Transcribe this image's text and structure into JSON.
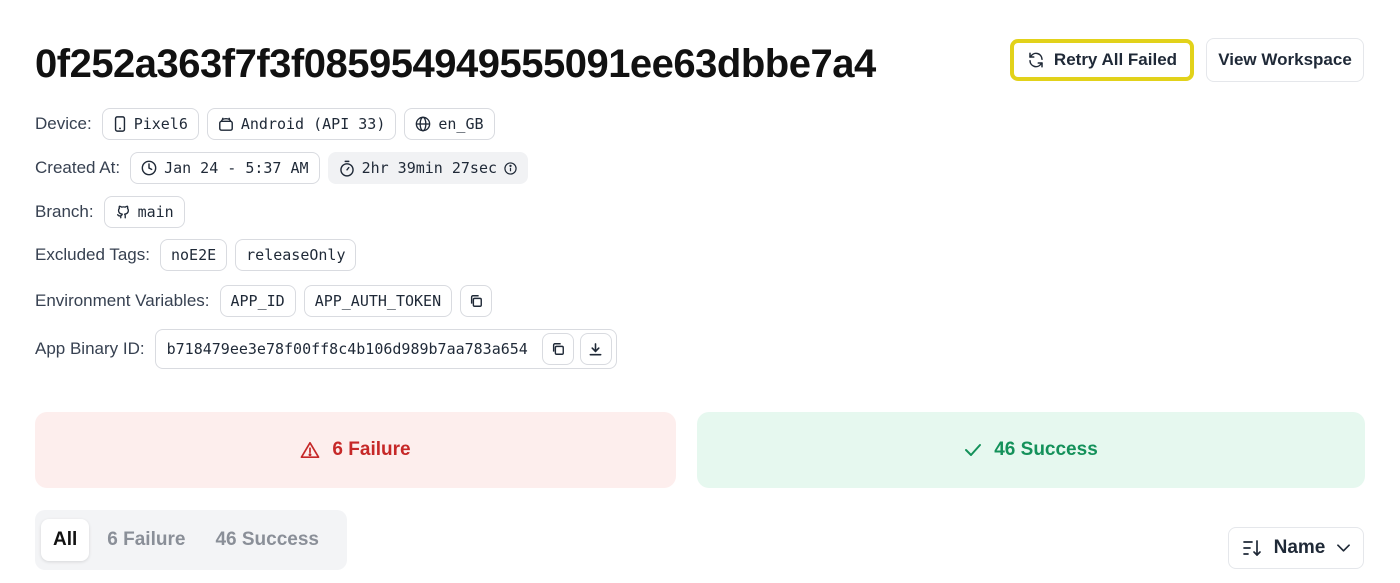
{
  "header": {
    "title": "0f252a363f7f3f0859549495550​91ee63dbbe7a4",
    "retry_label": "Retry All Failed",
    "workspace_label": "View Workspace"
  },
  "details": {
    "device": {
      "label": "Device:",
      "model": "Pixel6",
      "os": "Android (API 33)",
      "locale": "en_GB"
    },
    "created": {
      "label": "Created At:",
      "date": "Jan 24 - 5:37 AM",
      "duration": "2hr 39min 27sec"
    },
    "branch": {
      "label": "Branch:",
      "name": "main"
    },
    "excluded_tags": {
      "label": "Excluded Tags:",
      "tags": [
        "noE2E",
        "releaseOnly"
      ]
    },
    "env_vars": {
      "label": "Environment Variables:",
      "vars": [
        "APP_ID",
        "APP_AUTH_TOKEN"
      ]
    },
    "binary": {
      "label": "App Binary ID:",
      "id": "b718479ee3e78f00ff8c4b106d989b7aa783a654"
    }
  },
  "summary": {
    "failure_label": "6 Failure",
    "success_label": "46 Success",
    "failure_color": "#c62828",
    "success_color": "#14915a"
  },
  "tabs": [
    "All",
    "6 Failure",
    "46 Success"
  ],
  "sort": {
    "label": "Name"
  },
  "icons": [
    "refresh-icon",
    "phone-icon",
    "android-icon",
    "globe-icon",
    "clock-icon",
    "stopwatch-icon",
    "info-icon",
    "github-icon",
    "copy-icon",
    "download-icon",
    "warning-icon",
    "check-icon",
    "sort-icon",
    "chevron-down-icon"
  ]
}
